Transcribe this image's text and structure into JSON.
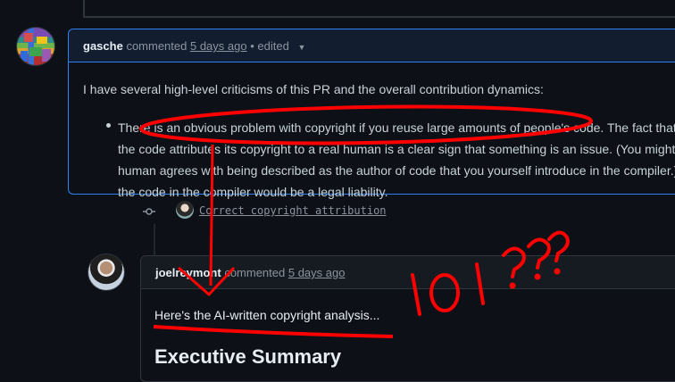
{
  "comment1": {
    "author": "gasche",
    "action": "commented",
    "time": "5 days ago",
    "edited": "• edited",
    "intro": "I have several high-level criticisms of this PR and the overall contribution dynamics:",
    "bullet_lines": [
      "There is an obvious problem with copyright if you reuse large amounts of people's code. The fact that the",
      "the code attributes its copyright to a real human is a clear sign that something is an issue. (You might als",
      "human agrees with being described as the author of code that you yourself introduce in the compiler.) At",
      "the code in the compiler would be a legal liability."
    ]
  },
  "commit": {
    "message": "Correct copyright attribution"
  },
  "comment2": {
    "author": "joelreymont",
    "action": "commented",
    "time": "5 days ago",
    "body": "Here's the AI-written copyright analysis...",
    "heading": "Executive Summary"
  },
  "annotation": {
    "text": "lol ???",
    "color": "#ff0000"
  },
  "colors": {
    "background": "#0d1117",
    "accent": "#2f81f7",
    "text": "#c9d1d9",
    "muted": "#8b949e"
  }
}
